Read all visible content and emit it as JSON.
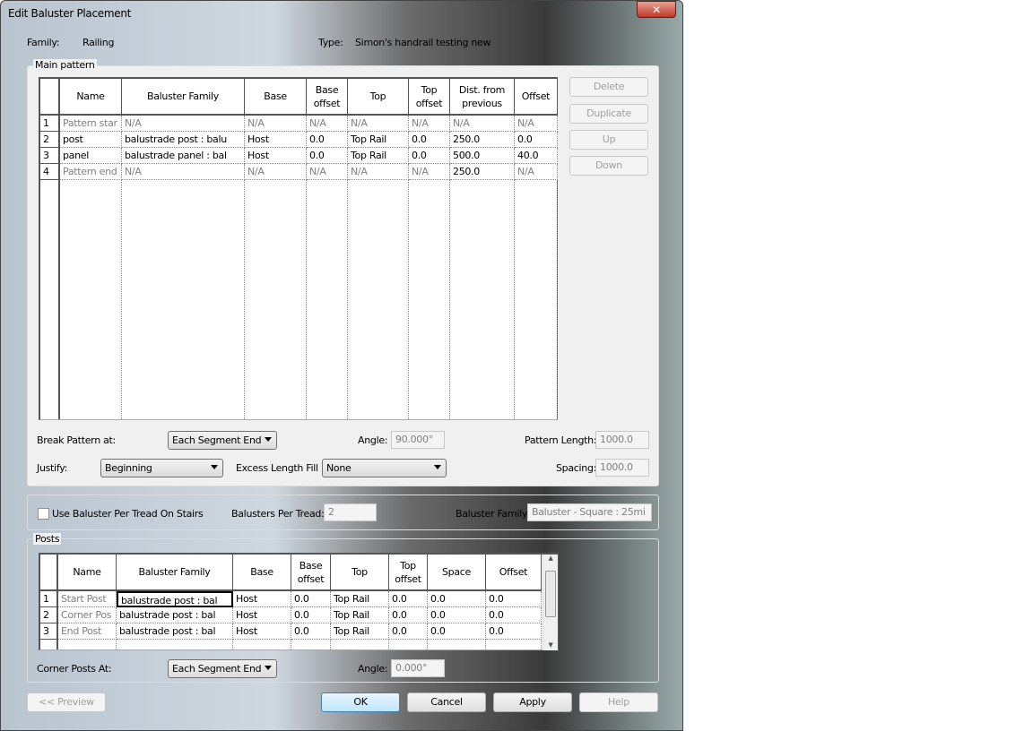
{
  "window": {
    "title": "Edit Baluster Placement",
    "close": "✕"
  },
  "header": {
    "family_label": "Family:",
    "family_value": "Railing",
    "type_label": "Type:",
    "type_value": "Simon's handrail testing new"
  },
  "main_pattern": {
    "label": "Main pattern",
    "columns": [
      "",
      "Name",
      "Baluster Family",
      "Base",
      "Base offset",
      "Top",
      "Top offset",
      "Dist. from previous",
      "Offset"
    ],
    "rows": [
      {
        "n": "1",
        "cells": [
          "Pattern star",
          "N/A",
          "N/A",
          "N/A",
          "N/A",
          "N/A",
          "N/A",
          "N/A"
        ],
        "disabled": true
      },
      {
        "n": "2",
        "cells": [
          "post",
          "balustrade post : balu",
          "Host",
          "0.0",
          "Top Rail",
          "0.0",
          "250.0",
          "0.0"
        ],
        "disabled": false
      },
      {
        "n": "3",
        "cells": [
          "panel",
          "balustrade panel : bal",
          "Host",
          "0.0",
          "Top Rail",
          "0.0",
          "500.0",
          "40.0"
        ],
        "disabled": false
      },
      {
        "n": "4",
        "cells": [
          "Pattern end",
          "N/A",
          "N/A",
          "N/A",
          "N/A",
          "N/A",
          "250.0",
          "N/A"
        ],
        "disabled": true
      }
    ],
    "buttons": {
      "delete": "Delete",
      "duplicate": "Duplicate",
      "up": "Up",
      "down": "Down"
    },
    "break_pattern_label": "Break Pattern at:",
    "break_pattern_value": "Each Segment End",
    "angle_label": "Angle:",
    "angle_value": "90.000°",
    "pattern_length_label": "Pattern Length:",
    "pattern_length_value": "1000.0",
    "justify_label": "Justify:",
    "justify_value": "Beginning",
    "excess_label": "Excess Length Fill :",
    "excess_value": "None",
    "spacing_label": "Spacing:",
    "spacing_value": "1000.0"
  },
  "stairs": {
    "checkbox_label": "Use Baluster Per Tread On Stairs",
    "checked": false,
    "per_tread_label": "Balusters Per Tread:",
    "per_tread_value": "2",
    "family_label": "Baluster Family:",
    "family_value": "Baluster - Square : 25mi"
  },
  "posts": {
    "label": "Posts",
    "columns": [
      "",
      "Name",
      "Baluster Family",
      "Base",
      "Base offset",
      "Top",
      "Top offset",
      "Space",
      "Offset"
    ],
    "rows": [
      {
        "n": "1",
        "cells": [
          "Start Post",
          "balustrade post : bal",
          "Host",
          "0.0",
          "Top Rail",
          "0.0",
          "0.0",
          "0.0"
        ]
      },
      {
        "n": "2",
        "cells": [
          "Corner Pos",
          "balustrade post : bal",
          "Host",
          "0.0",
          "Top Rail",
          "0.0",
          "0.0",
          "0.0"
        ]
      },
      {
        "n": "3",
        "cells": [
          "End Post",
          "balustrade post : bal",
          "Host",
          "0.0",
          "Top Rail",
          "0.0",
          "0.0",
          "0.0"
        ]
      }
    ],
    "corner_label": "Corner Posts At:",
    "corner_value": "Each Segment End",
    "angle_label": "Angle:",
    "angle_value": "0.000°"
  },
  "footer": {
    "preview": "<< Preview",
    "ok": "OK",
    "cancel": "Cancel",
    "apply": "Apply",
    "help": "Help"
  }
}
